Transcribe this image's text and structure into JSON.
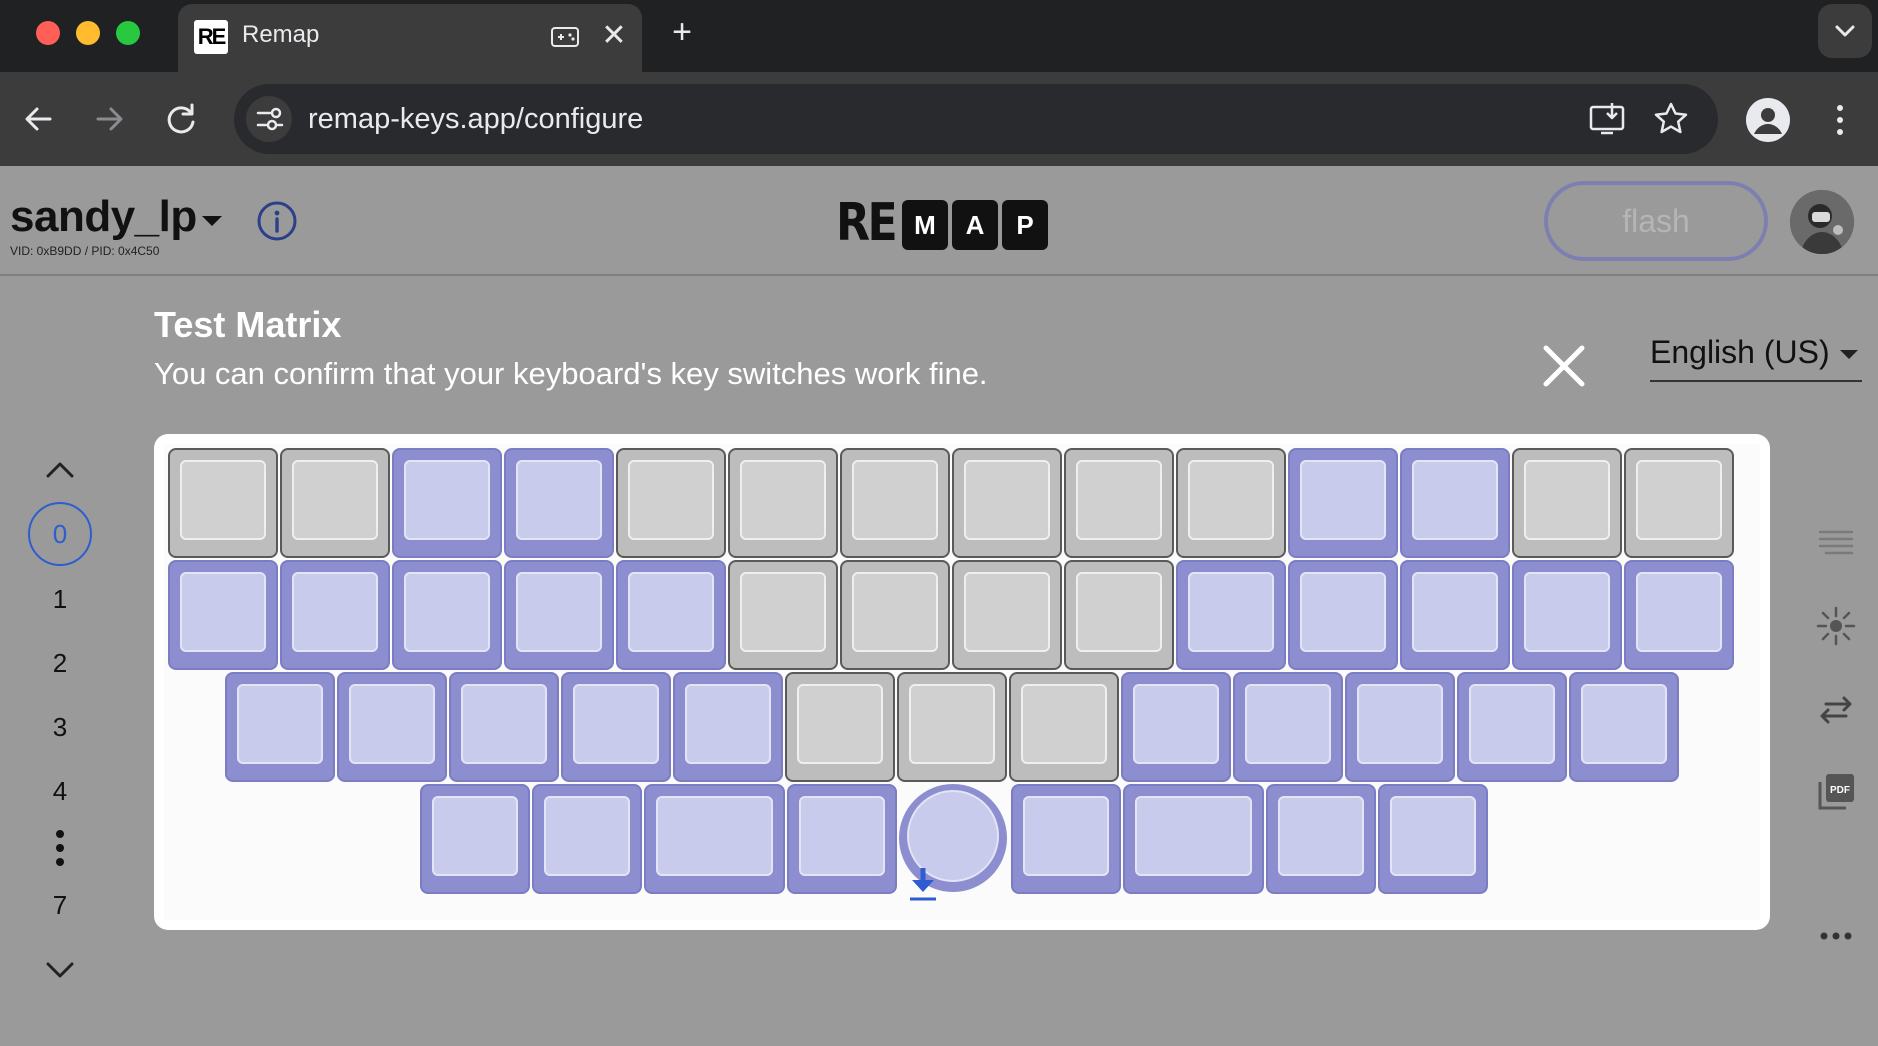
{
  "browser": {
    "tab_title": "Remap",
    "tab_favicon": "RE",
    "url": "remap-keys.app/configure",
    "icons": [
      "back-icon",
      "forward-icon",
      "reload-icon",
      "site-info-icon",
      "install-app-icon",
      "bookmark-star-icon",
      "profile-icon",
      "menu-kebab-icon",
      "tab-media-icon",
      "tab-close-icon",
      "new-tab-icon",
      "tab-search-icon"
    ]
  },
  "header": {
    "keyboard_name": "sandy_lp",
    "vid_pid": "VID: 0xB9DD / PID: 0x4C50",
    "logo_text": "RE",
    "logo_boxes": [
      "M",
      "A",
      "P"
    ],
    "flash_label": "flash"
  },
  "layers": {
    "selected": "0",
    "items": [
      "1",
      "2",
      "3",
      "4",
      "7"
    ]
  },
  "test_matrix": {
    "title": "Test Matrix",
    "description": "You can confirm that your keyboard's key switches work fine.",
    "language": "English (US)",
    "rows": [
      [
        "off",
        "off",
        "on",
        "on",
        "off",
        "off",
        "off",
        "off",
        "off",
        "off",
        "on",
        "on",
        "off",
        "off"
      ],
      [
        "on",
        "on",
        "on",
        "on",
        "on",
        "off",
        "off",
        "off",
        "off",
        "on",
        "on",
        "on",
        "on",
        "on"
      ],
      [
        "on",
        "on",
        "on",
        "on",
        "on",
        "off",
        "off",
        "off",
        "on",
        "on",
        "on",
        "on",
        "on"
      ],
      [
        "on",
        "on",
        "on",
        "on",
        "knob",
        "on",
        "on",
        "on",
        "on"
      ]
    ]
  },
  "colors": {
    "key_pressed": "#c9cbec",
    "key_pressed_border": "#8c8ed0",
    "key_idle": "#d0d0d0",
    "accent_blue": "#2d5dd0"
  },
  "rail_icons": [
    "list-icon",
    "lighting-icon",
    "swap-icon",
    "pdf-icon",
    "more-icon"
  ]
}
